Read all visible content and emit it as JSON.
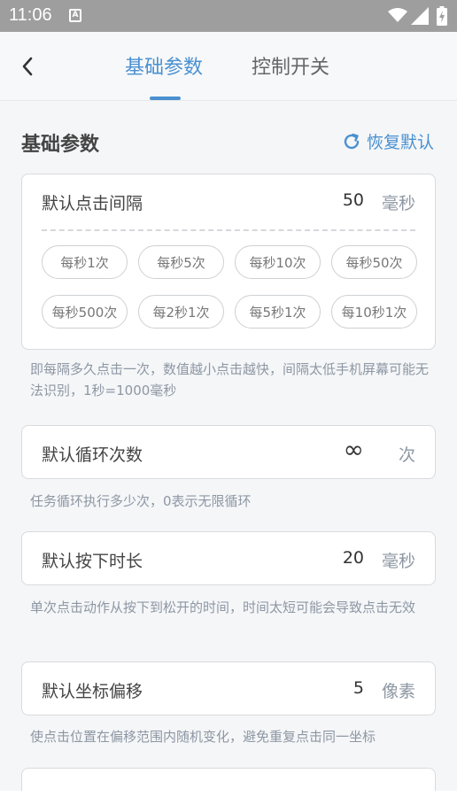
{
  "status_bar": {
    "time": "11:06",
    "notification_badge": "A"
  },
  "header": {
    "tabs": [
      {
        "label": "基础参数",
        "active": true
      },
      {
        "label": "控制开关",
        "active": false
      }
    ]
  },
  "section": {
    "title": "基础参数",
    "restore_label": "恢复默认"
  },
  "click_interval": {
    "label": "默认点击间隔",
    "value": "50",
    "unit": "毫秒",
    "presets": [
      "每秒1次",
      "每秒5次",
      "每秒10次",
      "每秒50次",
      "每秒500次",
      "每2秒1次",
      "每5秒1次",
      "每10秒1次"
    ],
    "description": "即每隔多久点击一次，数值越小点击越快，间隔太低手机屏幕可能无法识别，1秒=1000毫秒"
  },
  "loop_count": {
    "label": "默认循环次数",
    "value": "∞",
    "unit": "次",
    "description": "任务循环执行多少次，0表示无限循环"
  },
  "press_duration": {
    "label": "默认按下时长",
    "value": "20",
    "unit": "毫秒",
    "description": "单次点击动作从按下到松开的时间，时间太短可能会导致点击无效"
  },
  "coord_offset": {
    "label": "默认坐标偏移",
    "value": "5",
    "unit": "像素",
    "description": "使点击位置在偏移范围内随机变化，避免重复点击同一坐标"
  },
  "colors": {
    "accent": "#4a90d0",
    "muted": "#8d97a3"
  }
}
